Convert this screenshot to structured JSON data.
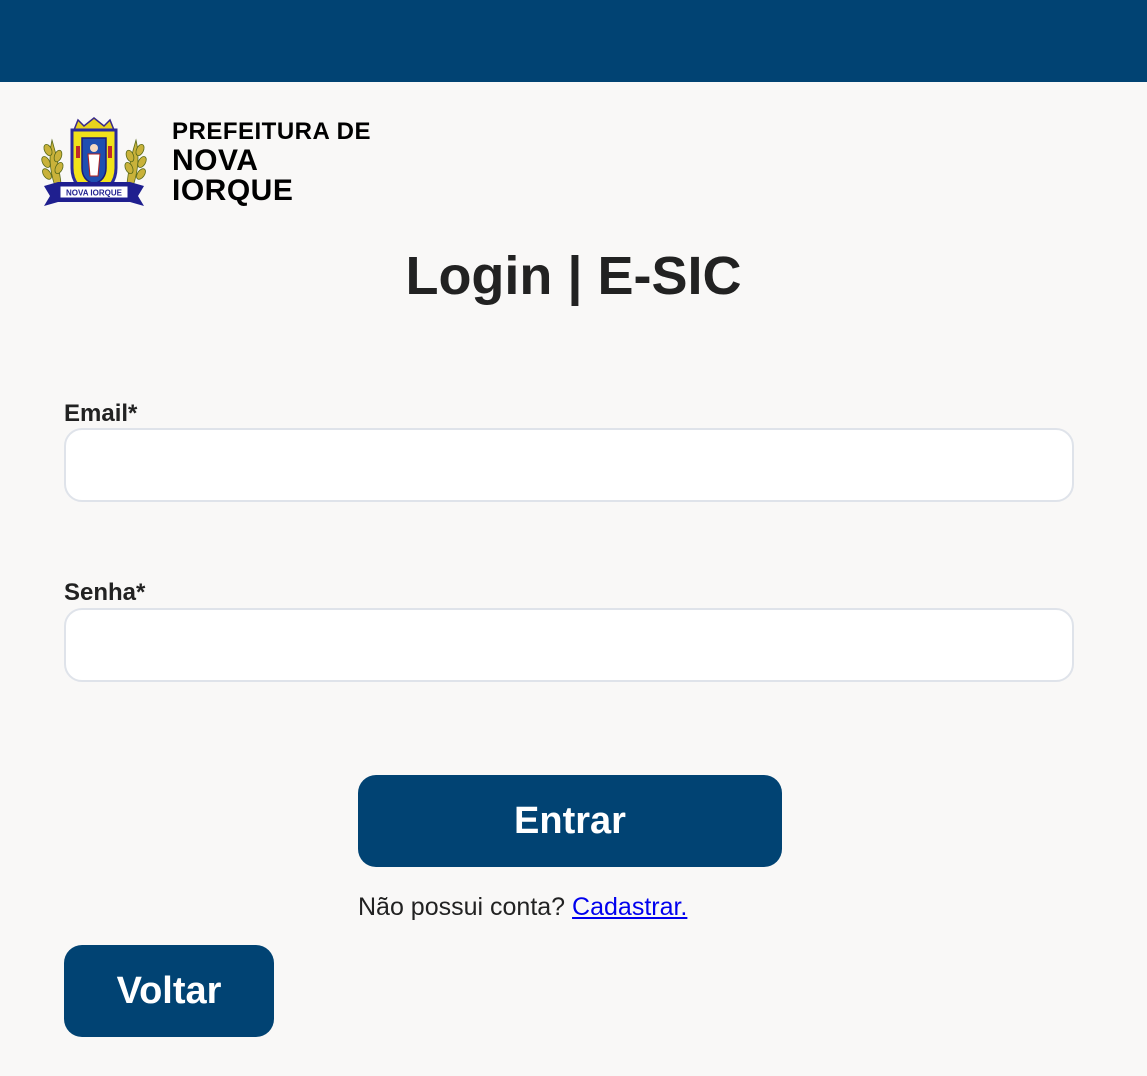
{
  "header": {
    "bar_color": "#014373"
  },
  "brand": {
    "line1": "PREFEITURA DE",
    "line2": "NOVA IORQUE",
    "crest_banner_text": "NOVA IORQUE"
  },
  "page": {
    "title": "Login | E-SIC"
  },
  "form": {
    "email_label": "Email*",
    "email_value": "",
    "password_label": "Senha*",
    "password_value": ""
  },
  "actions": {
    "submit_label": "Entrar",
    "signup_prompt": "Não possui conta?",
    "signup_link": "Cadastrar.",
    "back_label": "Voltar"
  },
  "colors": {
    "primary": "#014373",
    "background": "#f9f8f7",
    "link": "#0000ee",
    "input_border": "#dfe3ea"
  }
}
